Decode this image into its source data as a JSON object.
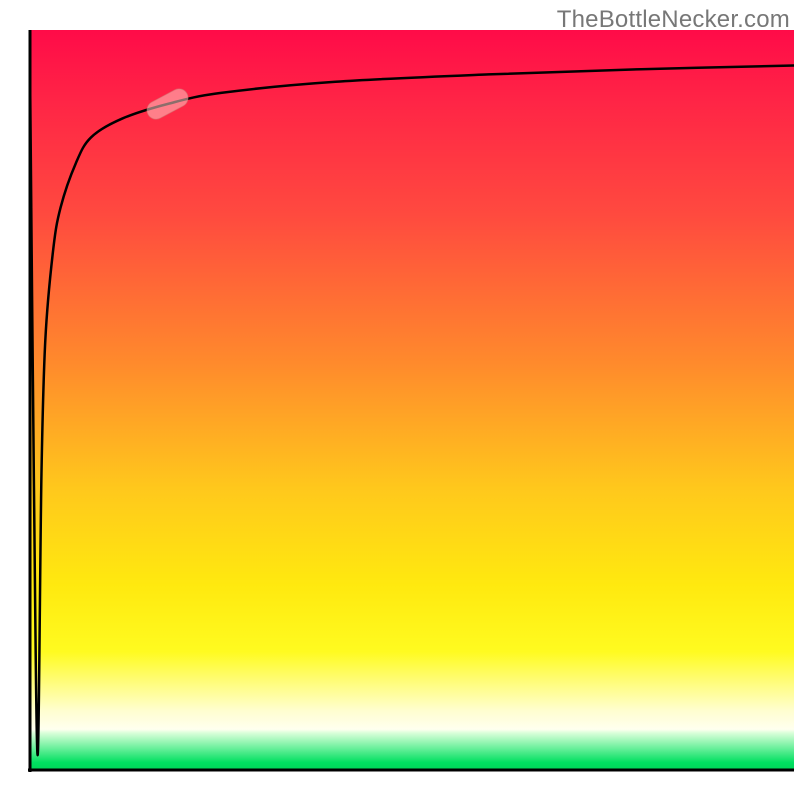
{
  "watermark": "TheBottleNecker.com",
  "colors": {
    "axis": "#000000",
    "curve": "#000000",
    "marker_fill": "#f5c2bb",
    "gradient_top": "#ff0b48",
    "gradient_bottom": "#00d658"
  },
  "chart_data": {
    "type": "line",
    "title": "",
    "xlabel": "",
    "ylabel": "",
    "xlim": [
      0,
      100
    ],
    "ylim": [
      0,
      100
    ],
    "x": [
      0,
      0.5,
      1,
      1.5,
      2,
      3,
      4,
      6,
      8,
      12,
      18,
      25,
      40,
      60,
      80,
      100
    ],
    "values": [
      95,
      40,
      2,
      40,
      58,
      70,
      76,
      82,
      85.5,
      88,
      90,
      91.5,
      93,
      94,
      94.7,
      95.2
    ],
    "marker": {
      "x": 18,
      "y": 90,
      "angle_deg": -28,
      "length": 6
    },
    "annotations": []
  }
}
